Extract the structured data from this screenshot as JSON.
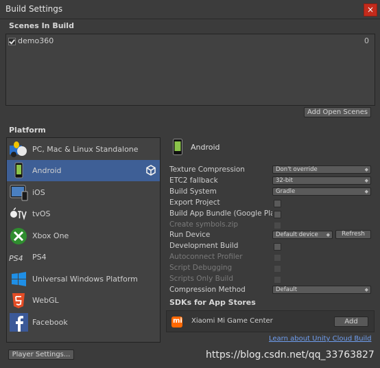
{
  "window": {
    "title": "Build Settings",
    "close_glyph": "×"
  },
  "scenes": {
    "header": "Scenes In Build",
    "items": [
      {
        "name": "demo360",
        "index": "0",
        "checked": true
      }
    ],
    "add_open_scenes": "Add Open Scenes"
  },
  "platform": {
    "header": "Platform",
    "items": [
      {
        "label": "PC, Mac & Linux Standalone",
        "icon": "standalone-icon"
      },
      {
        "label": "Android",
        "icon": "android-icon",
        "selected": true
      },
      {
        "label": "iOS",
        "icon": "ios-icon"
      },
      {
        "label": "tvOS",
        "icon": "tvos-icon"
      },
      {
        "label": "Xbox One",
        "icon": "xbox-icon"
      },
      {
        "label": "PS4",
        "icon": "ps4-icon"
      },
      {
        "label": "Universal Windows Platform",
        "icon": "windows-icon"
      },
      {
        "label": "WebGL",
        "icon": "html5-icon"
      },
      {
        "label": "Facebook",
        "icon": "facebook-icon"
      }
    ]
  },
  "settings": {
    "title": "Android",
    "texture_compression": {
      "label": "Texture Compression",
      "value": "Don't override"
    },
    "etc2_fallback": {
      "label": "ETC2 fallback",
      "value": "32-bit"
    },
    "build_system": {
      "label": "Build System",
      "value": "Gradle"
    },
    "export_project": {
      "label": "Export Project"
    },
    "build_app_bundle": {
      "label": "Build App Bundle (Google Play)"
    },
    "create_symbols": {
      "label": "Create symbols.zip"
    },
    "run_device": {
      "label": "Run Device",
      "value": "Default device",
      "refresh": "Refresh"
    },
    "development_build": {
      "label": "Development Build"
    },
    "autoconnect_profiler": {
      "label": "Autoconnect Profiler"
    },
    "script_debugging": {
      "label": "Script Debugging"
    },
    "scripts_only_build": {
      "label": "Scripts Only Build"
    },
    "compression_method": {
      "label": "Compression Method",
      "value": "Default"
    }
  },
  "sdks": {
    "header": "SDKs for App Stores",
    "items": [
      {
        "name": "Xiaomi Mi Game Center",
        "add": "Add"
      }
    ]
  },
  "links": {
    "cloud_build": "Learn about Unity Cloud Build"
  },
  "footer": {
    "player_settings": "Player Settings..."
  },
  "watermark": "https://blog.csdn.net/qq_33763827",
  "colors": {
    "background": "#3b3b3b",
    "selection": "#3e5f96",
    "link": "#6f9ef0",
    "close": "#c42b1c"
  }
}
